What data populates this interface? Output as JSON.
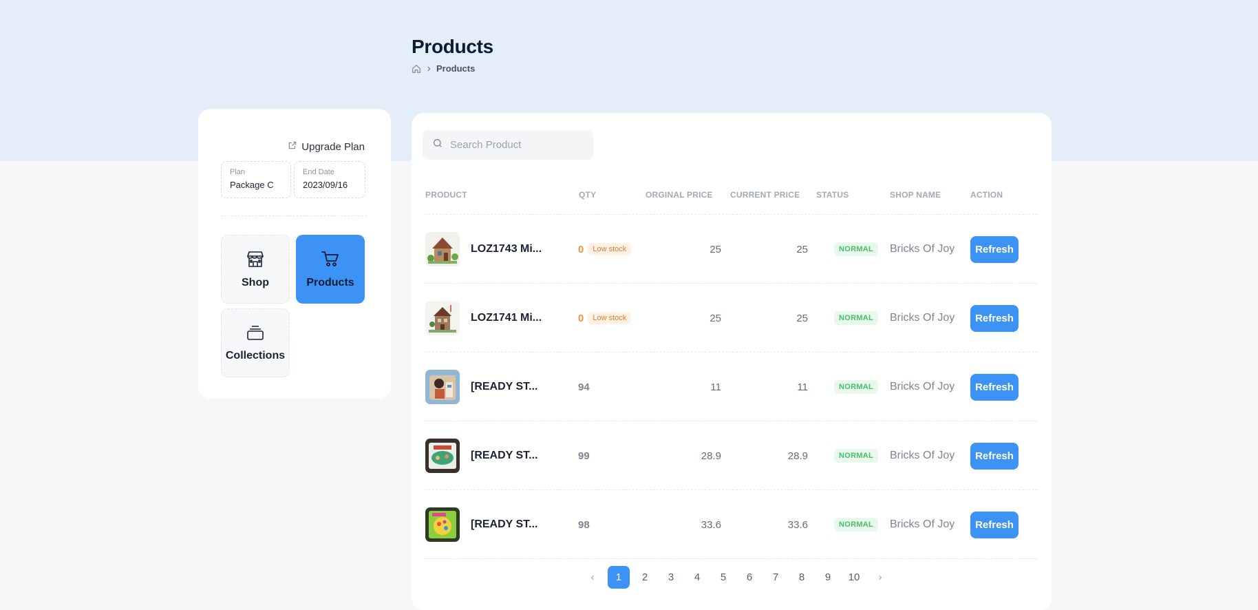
{
  "page": {
    "title": "Products",
    "breadcrumb": {
      "home_icon": "home-icon",
      "current": "Products"
    }
  },
  "sidebar": {
    "upgrade_label": "Upgrade Plan",
    "plan_label": "Plan",
    "plan_value": "Package C",
    "end_date_label": "End Date",
    "end_date_value": "2023/09/16",
    "tiles": [
      {
        "label": "Shop",
        "icon": "storefront-icon",
        "active": false
      },
      {
        "label": "Products",
        "icon": "cart-icon",
        "active": true
      },
      {
        "label": "Collections",
        "icon": "stack-icon",
        "active": false
      }
    ]
  },
  "search": {
    "placeholder": "Search Product"
  },
  "table": {
    "columns": [
      "PRODUCT",
      "QTY",
      "ORGINAL PRICE",
      "CURRENT PRICE",
      "STATUS",
      "SHOP NAME",
      "ACTION"
    ],
    "rows": [
      {
        "name": "LOZ1743 Mi...",
        "qty": "0",
        "low_stock": "Low stock",
        "original_price": "25",
        "current_price": "25",
        "status": "NORMAL",
        "shop": "Bricks Of Joy",
        "action": "Refresh"
      },
      {
        "name": "LOZ1741 Mi...",
        "qty": "0",
        "low_stock": "Low stock",
        "original_price": "25",
        "current_price": "25",
        "status": "NORMAL",
        "shop": "Bricks Of Joy",
        "action": "Refresh"
      },
      {
        "name": "[READY ST...",
        "qty": "94",
        "original_price": "11",
        "current_price": "11",
        "status": "NORMAL",
        "shop": "Bricks Of Joy",
        "action": "Refresh"
      },
      {
        "name": "[READY ST...",
        "qty": "99",
        "original_price": "28.9",
        "current_price": "28.9",
        "status": "NORMAL",
        "shop": "Bricks Of Joy",
        "action": "Refresh"
      },
      {
        "name": "[READY ST...",
        "qty": "98",
        "original_price": "33.6",
        "current_price": "33.6",
        "status": "NORMAL",
        "shop": "Bricks Of Joy",
        "action": "Refresh"
      }
    ]
  },
  "pagination": {
    "prev": "‹",
    "next": "›",
    "pages": [
      "1",
      "2",
      "3",
      "4",
      "5",
      "6",
      "7",
      "8",
      "9",
      "10"
    ],
    "current": "1"
  },
  "colors": {
    "accent": "#3d93f5",
    "header_band": "#e4eef9",
    "status_normal": "#45c06a",
    "low_stock": "#f0913d"
  }
}
